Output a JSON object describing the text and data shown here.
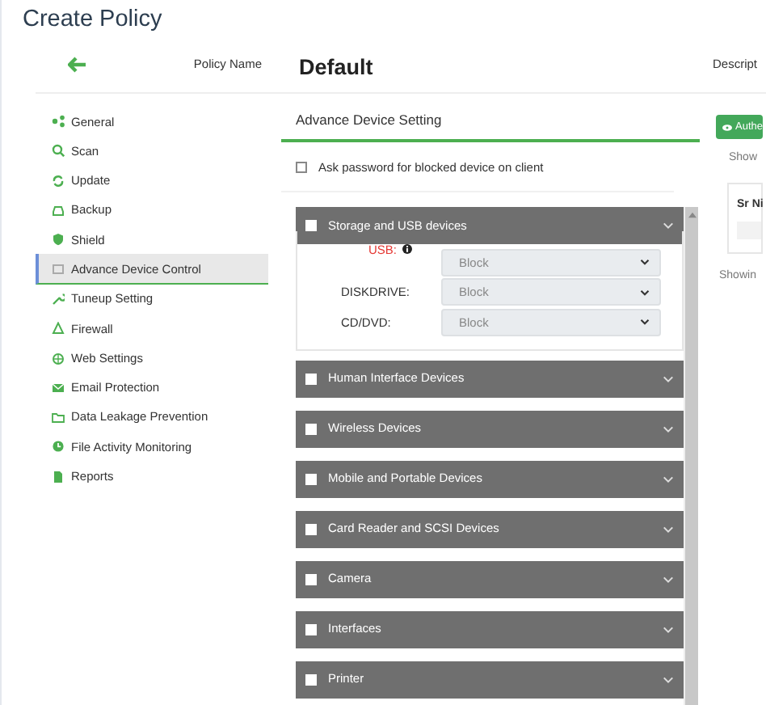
{
  "page_title": "Create Policy",
  "header": {
    "field_label": "Policy Name",
    "policy_name": "Default",
    "column_3": "Descript"
  },
  "sidebar": {
    "items": [
      {
        "label": "General",
        "selected": false
      },
      {
        "label": "Scan",
        "selected": false
      },
      {
        "label": "Update",
        "selected": false
      },
      {
        "label": "Backup",
        "selected": false
      },
      {
        "label": "Shield",
        "selected": false
      },
      {
        "label": "Advance Device Control",
        "selected": true
      },
      {
        "label": "Tuneup Setting",
        "selected": false
      },
      {
        "label": "Firewall",
        "selected": false
      },
      {
        "label": "Web Settings",
        "selected": false
      },
      {
        "label": "Email Protection",
        "selected": false
      },
      {
        "label": "Data Leakage Prevention",
        "selected": false
      },
      {
        "label": "File Activity Monitoring",
        "selected": false
      },
      {
        "label": "Reports",
        "selected": false
      }
    ]
  },
  "section_title": "Advance Device Setting",
  "ask_password": {
    "label": "Ask password for blocked device on client",
    "checked": false
  },
  "device_groups": [
    {
      "label": "Storage and USB devices",
      "checked": false,
      "expanded": true,
      "settings": [
        {
          "label": "USB:",
          "alert": true,
          "value": "Block"
        },
        {
          "label": "DISKDRIVE:",
          "alert": false,
          "value": "Block"
        },
        {
          "label": "CD/DVD:",
          "alert": false,
          "value": "Block"
        }
      ]
    },
    {
      "label": "Human Interface Devices",
      "checked": false,
      "expanded": false
    },
    {
      "label": "Wireless Devices",
      "checked": false,
      "expanded": false
    },
    {
      "label": "Mobile and Portable Devices",
      "checked": false,
      "expanded": false
    },
    {
      "label": "Card Reader and SCSI Devices",
      "checked": false,
      "expanded": false
    },
    {
      "label": "Camera",
      "checked": false,
      "expanded": false
    },
    {
      "label": "Interfaces",
      "checked": false,
      "expanded": false
    },
    {
      "label": "Printer",
      "checked": false,
      "expanded": false
    }
  ],
  "side_panel": {
    "button": "Authe",
    "show_label": "Show",
    "table_header": "Sr Ni",
    "footer": "Showin"
  }
}
